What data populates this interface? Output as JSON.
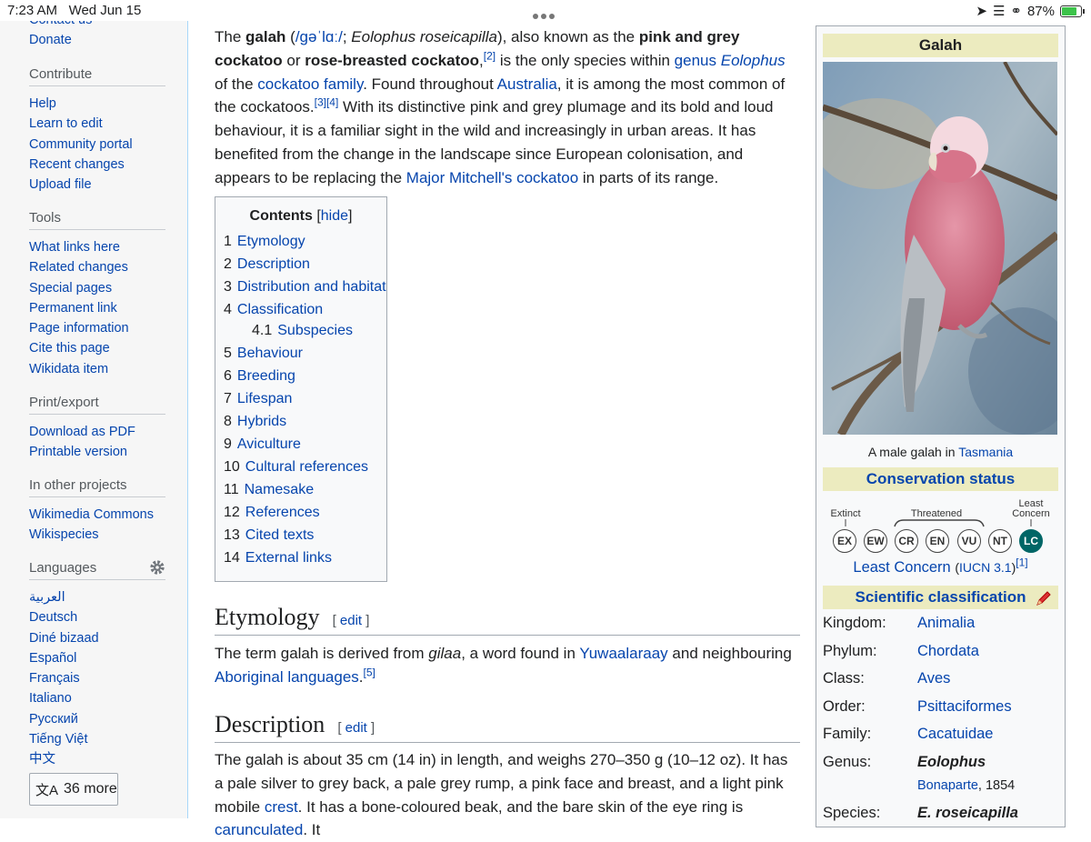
{
  "status_bar": {
    "time": "7:23 AM",
    "date": "Wed Jun 15",
    "battery": "87%",
    "battery_level": 0.87
  },
  "sidebar": {
    "top_partial": "Contact us",
    "top_items": [
      "Donate"
    ],
    "contribute": {
      "heading": "Contribute",
      "items": [
        "Help",
        "Learn to edit",
        "Community portal",
        "Recent changes",
        "Upload file"
      ]
    },
    "tools": {
      "heading": "Tools",
      "items": [
        "What links here",
        "Related changes",
        "Special pages",
        "Permanent link",
        "Page information",
        "Cite this page",
        "Wikidata item"
      ]
    },
    "print": {
      "heading": "Print/export",
      "items": [
        "Download as PDF",
        "Printable version"
      ]
    },
    "projects": {
      "heading": "In other projects",
      "items": [
        "Wikimedia Commons",
        "Wikispecies"
      ]
    },
    "languages": {
      "heading": "Languages",
      "items": [
        "العربية",
        "Deutsch",
        "Diné bizaad",
        "Español",
        "Français",
        "Italiano",
        "Русский",
        "Tiếng Việt",
        "中文"
      ],
      "more": "36 more"
    }
  },
  "intro": {
    "p1": "The",
    "b1": "galah",
    "ipa": "/ɡəˈlɑː/",
    "s1": ";",
    "sci": "Eolophus roseicapilla",
    "s2": "), also known as the",
    "b2": "pink and grey cockatoo",
    "s3": "or",
    "b3": "rose-breasted cockatoo",
    "ref2": "[2]",
    "s4": "is the only species within",
    "l_genus": "genus",
    "genus": "Eolophus",
    "s5": "of the",
    "l_family": "cockatoo family",
    "s6": ". Found throughout",
    "l_aus": "Australia",
    "s7": ", it is among the most common of the cockatoos.",
    "ref34": "[3][4]",
    "s8": "With its distinctive pink and grey plumage and its bold and loud behaviour, it is a familiar sight in the wild and increasingly in urban areas. It has benefited from the change in the landscape since European colonisation, and appears to be replacing the",
    "l_mm": "Major Mitchell's cockatoo",
    "s9": "in parts of its range."
  },
  "toc": {
    "title": "Contents",
    "hide": "hide",
    "items": [
      {
        "n": "1",
        "t": "Etymology"
      },
      {
        "n": "2",
        "t": "Description"
      },
      {
        "n": "3",
        "t": "Distribution and habitat"
      },
      {
        "n": "4",
        "t": "Classification"
      },
      {
        "n": "4.1",
        "t": "Subspecies"
      },
      {
        "n": "5",
        "t": "Behaviour"
      },
      {
        "n": "6",
        "t": "Breeding"
      },
      {
        "n": "7",
        "t": "Lifespan"
      },
      {
        "n": "8",
        "t": "Hybrids"
      },
      {
        "n": "9",
        "t": "Aviculture"
      },
      {
        "n": "10",
        "t": "Cultural references"
      },
      {
        "n": "11",
        "t": "Namesake"
      },
      {
        "n": "12",
        "t": "References"
      },
      {
        "n": "13",
        "t": "Cited texts"
      },
      {
        "n": "14",
        "t": "External links"
      }
    ]
  },
  "etymology": {
    "heading": "Etymology",
    "edit": "edit",
    "t1": "The term galah is derived from",
    "gilaa": "gilaa",
    "t2": ", a word found in",
    "l1": "Yuwaalaraay",
    "t3": "and neighbouring",
    "l2": "Aboriginal languages",
    "t4": ".",
    "ref": "[5]"
  },
  "description": {
    "heading": "Description",
    "edit": "edit",
    "t1": "The galah is about 35 cm (14 in) in length, and weighs 270–350 g (10–12 oz). It has a pale silver to grey back, a pale grey rump, a pink face and breast, and a light pink mobile",
    "l1": "crest",
    "t2": ". It has a bone-coloured beak, and the bare skin of the eye ring is",
    "l2": "carunculated",
    "t3": ". It"
  },
  "infobox": {
    "title": "Galah",
    "caption_pre": "A male galah in",
    "caption_link": "Tasmania",
    "conservation": "Conservation status",
    "cs_labels": {
      "extinct": "Extinct",
      "threatened": "Threatened",
      "least": "Least Concern"
    },
    "cs_codes": [
      "EX",
      "EW",
      "CR",
      "EN",
      "VU",
      "NT",
      "LC"
    ],
    "status": "Least Concern",
    "iucn": "IUCN 3.1",
    "ref": "[1]",
    "classification": "Scientific classification",
    "taxonomy": [
      {
        "k": "Kingdom:",
        "v": "Animalia"
      },
      {
        "k": "Phylum:",
        "v": "Chordata"
      },
      {
        "k": "Class:",
        "v": "Aves"
      },
      {
        "k": "Order:",
        "v": "Psittaciformes"
      },
      {
        "k": "Family:",
        "v": "Cacatuidae"
      },
      {
        "k": "Genus:",
        "v": "Eolophus"
      }
    ],
    "authority": "Bonaparte",
    "authority_year": ", 1854",
    "species_k": "Species:",
    "species_v": "E. roseicapilla"
  }
}
